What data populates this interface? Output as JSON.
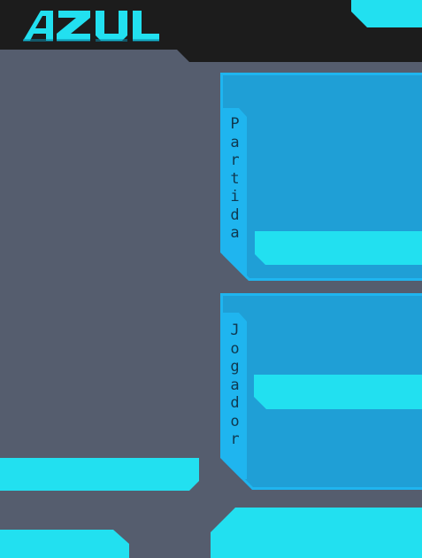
{
  "header": {
    "logo_text": "AZUL",
    "logo_color": "#22e0f0",
    "background_color": "#1c1c1c"
  },
  "panels": {
    "match": {
      "tab_label": "Partida"
    },
    "player": {
      "tab_label": "Jogador"
    }
  },
  "colors": {
    "background": "#555d6e",
    "accent_cyan": "#22e0f0",
    "panel_blue": "#1fb5ef",
    "panel_inner_blue": "#1f9fd6",
    "tab_text": "#10384f"
  }
}
